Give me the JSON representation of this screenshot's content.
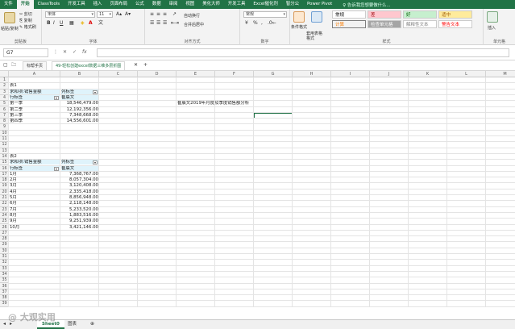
{
  "ribbon_tabs": [
    "文件",
    "开始",
    "ClassTools",
    "开发工具",
    "插入",
    "页面布局",
    "公式",
    "数据",
    "审阅",
    "视图",
    "美化大师",
    "开发工具",
    "Excel催化剂",
    "智分公",
    "Power Pivot"
  ],
  "active_tab": "开始",
  "tell_me": "♀ 告诉我您想要做什么...",
  "ribbon": {
    "clipboard": {
      "label": "剪贴板",
      "paste": "粘贴/复制",
      "cut": "✂ 剪切",
      "copy": "⎘ 复制",
      "format_painter": "✎ 格式刷"
    },
    "font": {
      "label": "字体",
      "font_name": "宋体",
      "font_size": "11",
      "bold": "B",
      "italic": "I",
      "underline": "U",
      "color_a": "A"
    },
    "alignment": {
      "label": "对齐方式",
      "wrap": "自动换行",
      "merge": "合并后居中"
    },
    "number": {
      "label": "数字",
      "format": "常规",
      "percent": "%",
      "comma": ","
    },
    "styles": {
      "label": "样式",
      "conditional": "条件格式",
      "table_format": "套用表格格式",
      "cells": [
        {
          "text": "常规",
          "bg": "#ffffff",
          "fg": "#000000"
        },
        {
          "text": "差",
          "bg": "#ffc7ce",
          "fg": "#9c0006"
        },
        {
          "text": "好",
          "bg": "#c6efce",
          "fg": "#006100"
        },
        {
          "text": "适中",
          "bg": "#ffeb9c",
          "fg": "#9c5700"
        },
        {
          "text": "计算",
          "bg": "#f2f2f2",
          "fg": "#fa7d00"
        },
        {
          "text": "检查单元格",
          "bg": "#a5a5a5",
          "fg": "#ffffff"
        },
        {
          "text": "解释性文本",
          "bg": "#ffffff",
          "fg": "#7f7f7f"
        },
        {
          "text": "警告文本",
          "bg": "#ffffff",
          "fg": "#ff0000"
        }
      ]
    },
    "cells": {
      "label": "单元格",
      "insert": "插入"
    }
  },
  "doc_tabs": [
    "标帮手页",
    "49-轻松创建excel数据三维多层折图",
    "+"
  ],
  "formula_bar": {
    "name_box": "G7",
    "cancel": "✕",
    "enter": "✓",
    "fx": "fx",
    "value": ""
  },
  "columns": [
    "A",
    "B",
    "C",
    "D",
    "E",
    "F",
    "G",
    "H",
    "I",
    "J",
    "K",
    "L",
    "M",
    "N",
    "O"
  ],
  "rows": [
    "1",
    "2",
    "3",
    "4",
    "5",
    "6",
    "7",
    "8",
    "9",
    "10",
    "11",
    "12",
    "13",
    "14",
    "15",
    "16",
    "17",
    "18",
    "19",
    "20",
    "21",
    "22",
    "23",
    "24",
    "25",
    "26",
    "27",
    "28",
    "29",
    "30",
    "31",
    "32",
    "33",
    "34",
    "35",
    "36",
    "37",
    "38",
    "39"
  ],
  "pivot1": {
    "table_label": "表1",
    "sum_label": "求和项:销售金额",
    "col_label": "列标签",
    "row_label": "行标签",
    "salesperson": "崔晨文",
    "rows": [
      {
        "label": "第一季",
        "value": "18,546,479.00"
      },
      {
        "label": "第二季",
        "value": "12,192,356.00"
      },
      {
        "label": "第三季",
        "value": "7,348,668.00"
      },
      {
        "label": "第四季",
        "value": "14,556,601.00"
      }
    ]
  },
  "pivot2": {
    "table_label": "表2",
    "sum_label": "求和项:销售金额",
    "col_label": "列标签",
    "row_label": "行标签",
    "salesperson": "崔晨文",
    "rows": [
      {
        "label": "1月",
        "value": "7,368,767.00"
      },
      {
        "label": "2月",
        "value": "8,057,304.00"
      },
      {
        "label": "3月",
        "value": "3,120,408.00"
      },
      {
        "label": "4月",
        "value": "2,335,418.00"
      },
      {
        "label": "5月",
        "value": "8,856,948.00"
      },
      {
        "label": "6月",
        "value": "2,118,148.00"
      },
      {
        "label": "7月",
        "value": "5,233,520.00"
      },
      {
        "label": "8月",
        "value": "1,883,516.00"
      },
      {
        "label": "9月",
        "value": "9,251,939.00"
      },
      {
        "label": "10月",
        "value": "3,421,146.00"
      }
    ]
  },
  "chart_title_text": "崔晨文2019年月度及季度销售额分析",
  "sheet_tabs": [
    "Sheet0",
    "图表"
  ],
  "active_sheet": "Sheet0",
  "watermark": "@ 大观实用"
}
